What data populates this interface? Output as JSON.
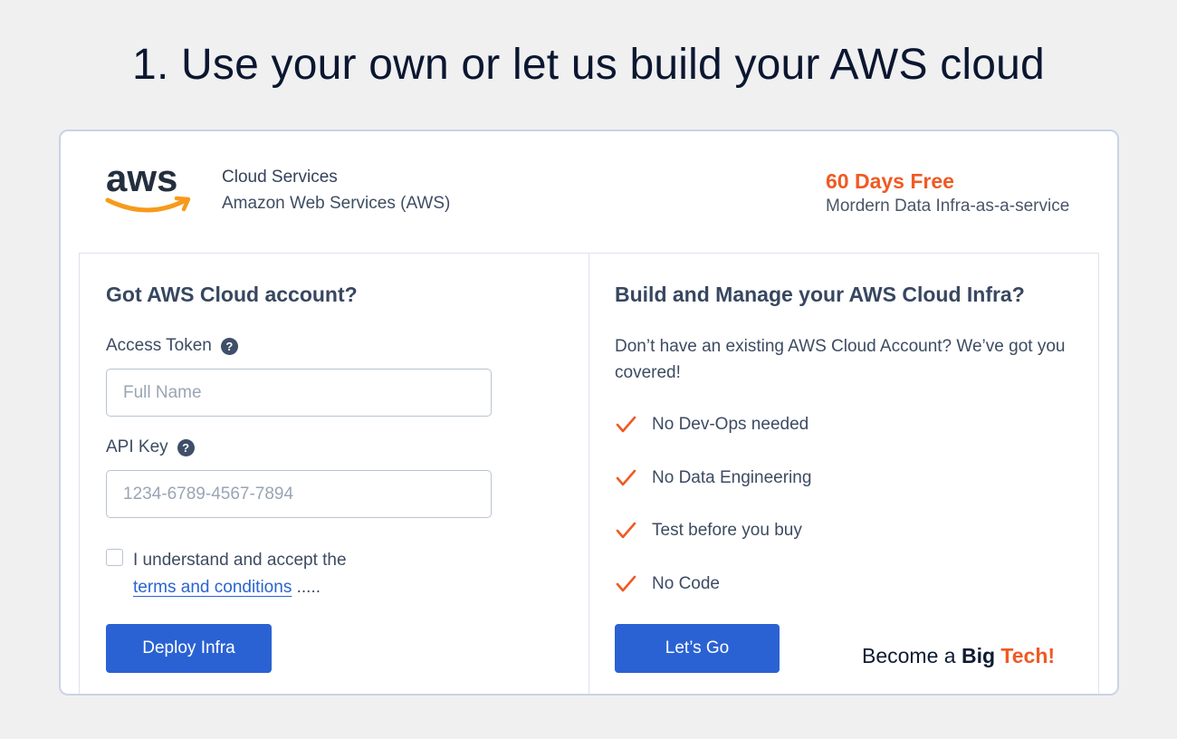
{
  "headline": "1. Use your own or let us build your AWS cloud",
  "brand": {
    "logo_text": "aws",
    "line1": "Cloud Services",
    "line2": "Amazon Web Services (AWS)"
  },
  "promo": {
    "title": "60 Days Free",
    "subtitle": "Mordern Data Infra-as-a-service"
  },
  "left_panel": {
    "title": "Got AWS Cloud account?",
    "access_token_label": "Access Token",
    "access_token_placeholder": "Full Name",
    "api_key_label": "API Key",
    "api_key_placeholder": "1234-6789-4567-7894",
    "consent_text": "I understand and accept the",
    "terms_link": "terms and conditions",
    "consent_suffix": " .....",
    "deploy_button": "Deploy Infra"
  },
  "right_panel": {
    "title": "Build and Manage your AWS Cloud Infra?",
    "description": "Don’t have an existing AWS Cloud Account? We’ve got you covered!",
    "features": [
      "No Dev-Ops needed",
      "No Data Engineering",
      "Test before you buy",
      "No Code"
    ],
    "cta_button": "Let’s Go",
    "tagline_prefix": "Become a ",
    "tagline_bold": "Big",
    "tagline_accent": "Tech!"
  },
  "colors": {
    "accent": "#ef5a24",
    "primary": "#2a62d3",
    "aws_orange": "#f79a1b"
  },
  "icons": {
    "help": "question-circle-icon",
    "feature": "checkmark-icon"
  }
}
